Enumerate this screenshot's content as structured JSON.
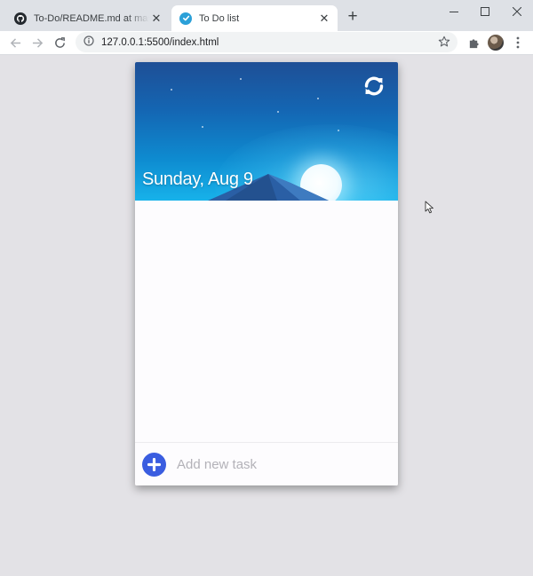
{
  "browser": {
    "tabs": [
      {
        "title": "To-Do/README.md at master · a",
        "icon": "github-icon",
        "active": false
      },
      {
        "title": "To Do list",
        "icon": "todo-check-icon",
        "active": true
      }
    ],
    "address": "127.0.0.1:5500/index.html"
  },
  "app": {
    "date": "Sunday, Aug 9",
    "add_task_placeholder": "Add new task",
    "tasks": []
  },
  "colors": {
    "accent": "#3a5de0",
    "hero_top": "#1e4f96",
    "hero_bottom": "#17b2ea",
    "page_bg": "#e3e2e6"
  }
}
